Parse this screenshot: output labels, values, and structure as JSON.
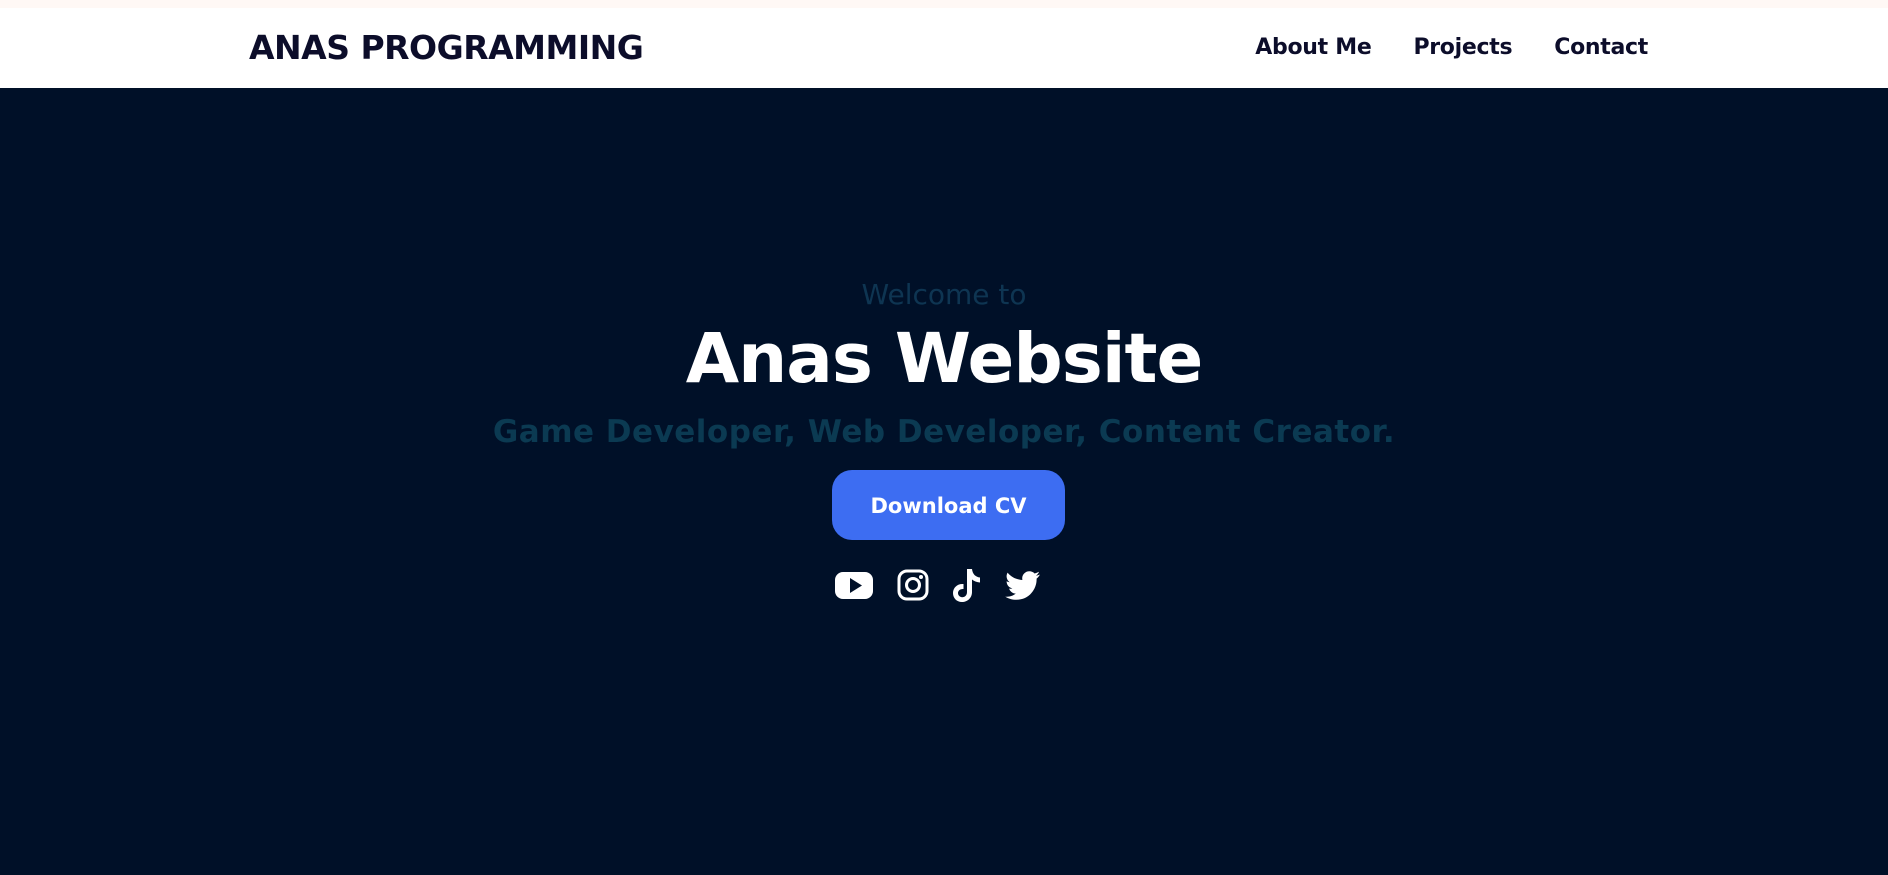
{
  "navbar": {
    "brand": "ANAS PROGRAMMING",
    "links": [
      {
        "label": "About Me"
      },
      {
        "label": "Projects"
      },
      {
        "label": "Contact"
      }
    ]
  },
  "hero": {
    "welcome": "Welcome to",
    "title": "Anas Website",
    "subtitle": "Game Developer, Web Developer, Content Creator.",
    "cta_label": "Download CV"
  },
  "socials": [
    {
      "icon": "youtube-icon"
    },
    {
      "icon": "instagram-icon"
    },
    {
      "icon": "tiktok-icon"
    },
    {
      "icon": "twitter-icon"
    }
  ],
  "colors": {
    "background": "#001028",
    "navbar": "#ffffff",
    "brand_text": "#0c0d2a",
    "accent_button": "#3d6df2",
    "muted_text": "#0b3a52"
  }
}
